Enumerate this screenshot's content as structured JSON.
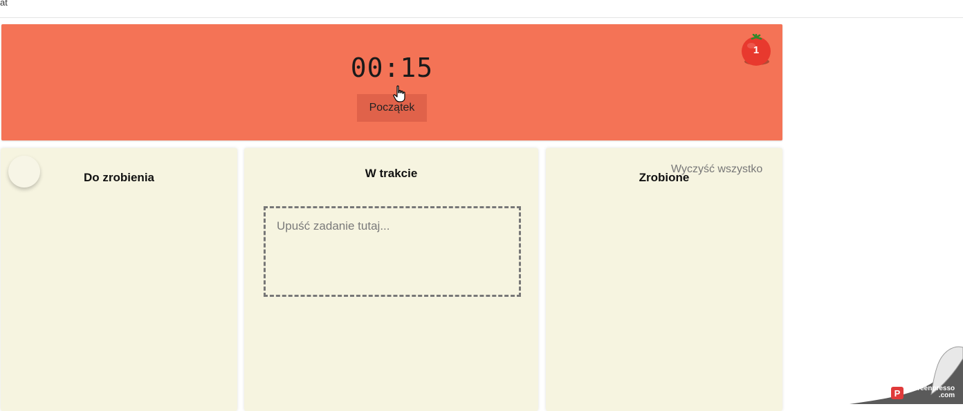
{
  "topbar": {
    "text": "at"
  },
  "timer": {
    "display": "00:15",
    "start_label": "Początek",
    "pomodoro_count": "1"
  },
  "columns": {
    "todo": {
      "title": "Do zrobienia"
    },
    "in_progress": {
      "title": "W trakcie",
      "drop_placeholder": "Upuść zadanie tutaj..."
    },
    "done": {
      "title": "Zrobione",
      "clear_all_label": "Wyczyść wszystko"
    }
  },
  "watermark": {
    "line1": "Screenpresso",
    "line2": ".com"
  },
  "colors": {
    "timer_background": "#f47356",
    "start_button": "#e0624a",
    "column_background": "#f6f4e0",
    "tomato_red": "#e8392e"
  },
  "icons": [
    "pointer-hand-icon",
    "tomato-icon",
    "add-task-icon",
    "screenpresso-logo-icon"
  ]
}
